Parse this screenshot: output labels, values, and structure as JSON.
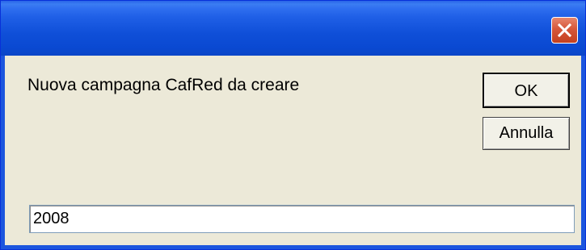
{
  "dialog": {
    "title": "",
    "close_icon": "close-icon",
    "prompt": "Nuova campagna CafRed da creare",
    "ok_label": "OK",
    "cancel_label": "Annulla",
    "input_value": "2008"
  },
  "colors": {
    "titlebar": "#0a49d2",
    "body": "#ece9d8",
    "close_button": "#d6573a"
  }
}
